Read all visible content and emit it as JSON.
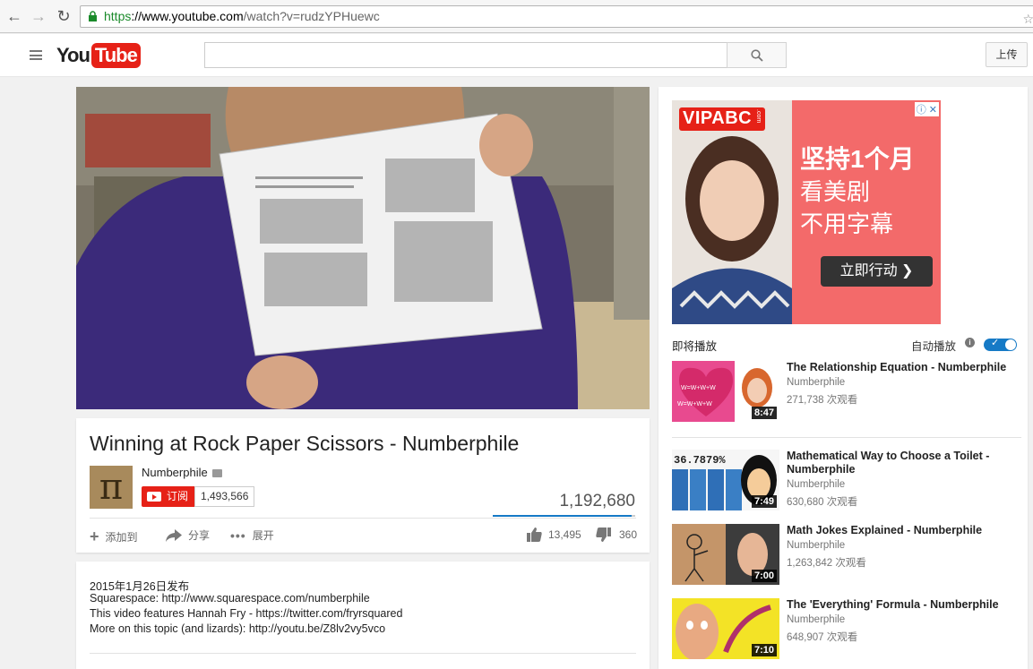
{
  "browser": {
    "url_scheme": "https",
    "url_host": "://www.youtube.com",
    "url_path": "/watch?v=rudzYPHuewc",
    "back_icon": "arrow-left-icon",
    "forward_icon": "arrow-right-icon",
    "reload_icon": "reload-icon"
  },
  "header": {
    "logo_you": "You",
    "logo_tube": "Tube",
    "search_placeholder": "",
    "upload_label": "上传"
  },
  "video": {
    "title": "Winning at Rock Paper Scissors - Numberphile",
    "channel": "Numberphile",
    "subscribe_label": "订阅",
    "subscriber_count": "1,493,566",
    "view_count": "1,192,680",
    "like_ratio": 0.974,
    "add_to_label": "添加到",
    "share_label": "分享",
    "more_label": "展开",
    "likes": "13,495",
    "dislikes": "360"
  },
  "description": {
    "published": "2015年1月26日发布",
    "line1": "Squarespace: http://www.squarespace.com/numberphile",
    "line2": "This video features Hannah Fry - https://twitter.com/fryrsquared",
    "line3": "More on this topic (and lizards): http://youtu.be/Z8lv2vy5vco"
  },
  "ad": {
    "brand": "VIPABC",
    "brand_suffix": ".com",
    "headline1": "坚持1个月",
    "headline2": "看美剧",
    "headline3": "不用字幕",
    "cta": "立即行动 ❯"
  },
  "sidebar": {
    "up_next_label": "即将播放",
    "autoplay_label": "自动播放",
    "autoplay_on": true,
    "items": [
      {
        "title": "The Relationship Equation - Numberphile",
        "channel": "Numberphile",
        "views": "271,738 次观看",
        "duration": "8:47"
      },
      {
        "title": "Mathematical Way to Choose a Toilet - Numberphile",
        "channel": "Numberphile",
        "views": "630,680 次观看",
        "duration": "7:49"
      },
      {
        "title": "Math Jokes Explained - Numberphile",
        "channel": "Numberphile",
        "views": "1,263,842 次观看",
        "duration": "7:00"
      },
      {
        "title": "The 'Everything' Formula - Numberphile",
        "channel": "Numberphile",
        "views": "648,907 次观看",
        "duration": "7:10"
      }
    ]
  },
  "colors": {
    "brand_red": "#e62117",
    "accent_blue": "#167ac6",
    "ad_pink": "#f36a6a"
  }
}
